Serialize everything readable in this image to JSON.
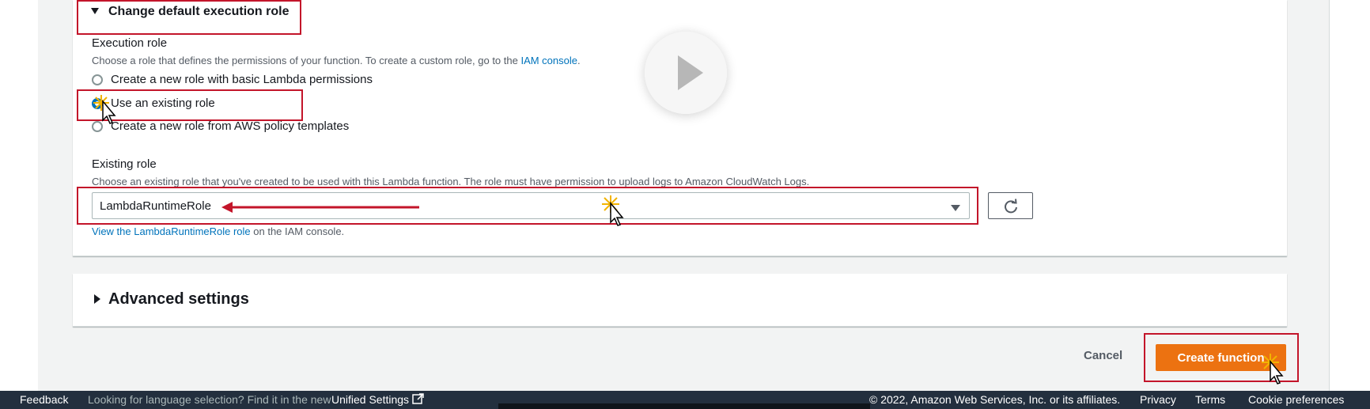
{
  "execution_role_section": {
    "toggle_label": "Change default execution role",
    "execution_role_label": "Execution role",
    "execution_role_desc": "Choose a role that defines the permissions of your function. To create a custom role, go to the ",
    "iam_console_link": "IAM console",
    "desc_end": ".",
    "options": [
      {
        "label": "Create a new role with basic Lambda permissions",
        "checked": false
      },
      {
        "label": "Use an existing role",
        "checked": true
      },
      {
        "label": "Create a new role from AWS policy templates",
        "checked": false
      }
    ]
  },
  "existing_role": {
    "label": "Existing role",
    "desc": "Choose an existing role that you've created to be used with this Lambda function. The role must have permission to upload logs to Amazon CloudWatch Logs.",
    "selected_value": "LambdaRuntimeRole",
    "view_link": "View the LambdaRuntimeRole role",
    "view_suffix": " on the IAM console."
  },
  "advanced": {
    "label": "Advanced settings"
  },
  "actions": {
    "cancel": "Cancel",
    "create": "Create function"
  },
  "footer": {
    "feedback": "Feedback",
    "language_hint": "Looking for language selection? Find it in the new ",
    "unified_settings": "Unified Settings",
    "copyright": "© 2022, Amazon Web Services, Inc. or its affiliates.",
    "privacy": "Privacy",
    "terms": "Terms",
    "cookies": "Cookie preferences"
  },
  "colors": {
    "accent": "#0073bb",
    "primary_button": "#ec7211",
    "annotation": "#c3152a",
    "footer_bg": "#232f3e"
  },
  "icons": [
    "caret-down-icon",
    "caret-right-icon",
    "refresh-icon",
    "dropdown-caret-icon",
    "external-link-icon",
    "play-icon",
    "cursor-icon",
    "click-burst-icon",
    "arrow-annotation-icon"
  ]
}
